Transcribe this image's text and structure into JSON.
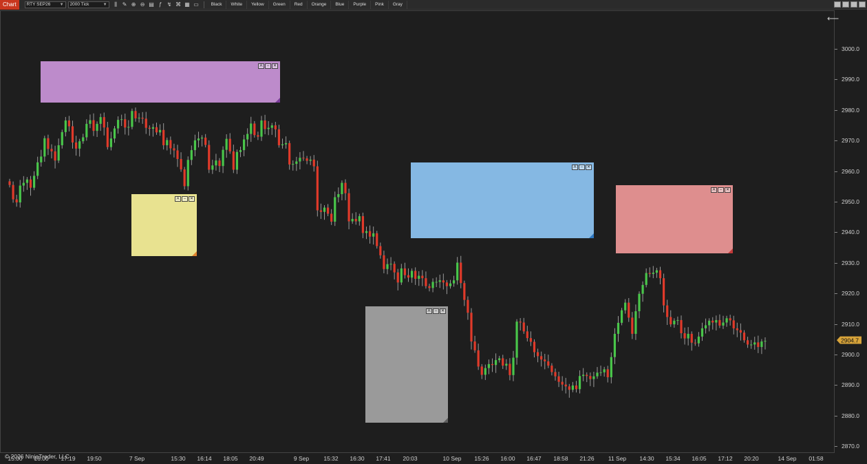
{
  "toolbar": {
    "tab_label": "Chart",
    "instrument": "RTY SEP26",
    "interval": "2000 Tick",
    "tools": [
      {
        "name": "bar-chart-icon",
        "glyph": "⫼"
      },
      {
        "name": "pencil-icon",
        "glyph": "✎"
      },
      {
        "name": "zoom-in-icon",
        "glyph": "⊕"
      },
      {
        "name": "zoom-out-icon",
        "glyph": "⊖"
      },
      {
        "name": "properties-icon",
        "glyph": "▤"
      },
      {
        "name": "indicators-icon",
        "glyph": "ƒ"
      },
      {
        "name": "strategies-icon",
        "glyph": "↯"
      },
      {
        "name": "templates-icon",
        "glyph": "⌘"
      },
      {
        "name": "chart-trader-icon",
        "glyph": "▦"
      },
      {
        "name": "note-icon",
        "glyph": "▭"
      }
    ],
    "color_buttons": [
      "Black",
      "White",
      "Yellow",
      "Green",
      "Red",
      "Orange",
      "Blue",
      "Purple",
      "Pink",
      "Gray"
    ]
  },
  "price_axis": {
    "labels": [
      "3000.0",
      "2990.0",
      "2980.0",
      "2970.0",
      "2960.0",
      "2950.0",
      "2940.0",
      "2930.0",
      "2920.0",
      "2910.0",
      "2900.0",
      "2890.0",
      "2880.0",
      "2870.0"
    ],
    "last_price": "2904.7"
  },
  "time_axis": {
    "labels": [
      "15:00",
      "16:00",
      "17:19",
      "19:50",
      "7 Sep",
      "15:30",
      "16:14",
      "18:05",
      "20:49",
      "9 Sep",
      "15:32",
      "16:30",
      "17:41",
      "20:03",
      "10 Sep",
      "15:26",
      "16:00",
      "16:47",
      "18:58",
      "21:26",
      "11 Sep",
      "14:30",
      "15:34",
      "16:05",
      "17:12",
      "20:20",
      "14 Sep",
      "01:58"
    ]
  },
  "copyright": "© 2026 NinjaTrader, LLC",
  "colors": {
    "up": "#49c64a",
    "down": "#e03a2a",
    "wick": "#9a9a9a",
    "background": "#1e1e1e"
  },
  "notes": [
    {
      "name": "sticky-note-purple",
      "color": "#bd8bcb",
      "corner": "#7b3c9a"
    },
    {
      "name": "sticky-note-yellow",
      "color": "#e8e290",
      "corner": "#e0832e"
    },
    {
      "name": "sticky-note-blue",
      "color": "#85b8e3",
      "corner": "#2e78c2"
    },
    {
      "name": "sticky-note-gray",
      "color": "#9a9a9a",
      "corner": "#5e5e5e"
    },
    {
      "name": "sticky-note-pink",
      "color": "#de8e8e",
      "corner": "#c23a3a"
    }
  ],
  "note_controls": {
    "font": "A",
    "minimize": "–",
    "close": "✕"
  },
  "chart_data": {
    "type": "candlestick",
    "ylim": [
      2866,
      3012
    ],
    "closes": [
      2955.7,
      2951.0,
      2950.0,
      2955.5,
      2956.4,
      2957.5,
      2954.8,
      2958.7,
      2963.1,
      2965.0,
      2971.0,
      2967.5,
      2966.7,
      2963.7,
      2968.7,
      2973.0,
      2976.8,
      2974.9,
      2969.6,
      2967.6,
      2970.0,
      2971.3,
      2975.7,
      2976.9,
      2973.4,
      2975.7,
      2977.9,
      2974.5,
      2968.1,
      2970.9,
      2974.2,
      2977.0,
      2977.2,
      2974.5,
      2974.7,
      2979.9,
      2977.5,
      2977.7,
      2977.4,
      2974.4,
      2974.1,
      2974.6,
      2972.9,
      2973.7,
      2968.7,
      2970.4,
      2967.7,
      2967.0,
      2964.2,
      2960.8,
      2955.3,
      2963.9,
      2967.1,
      2970.3,
      2970.9,
      2971.2,
      2968.8,
      2960.7,
      2962.1,
      2963.7,
      2961.9,
      2967.2,
      2970.8,
      2966.7,
      2960.7,
      2966.5,
      2967.1,
      2970.6,
      2972.4,
      2975.8,
      2972.0,
      2971.5,
      2976.8,
      2974.0,
      2974.4,
      2975.2,
      2973.9,
      2968.7,
      2969.0,
      2969.4,
      2962.4,
      2962.6,
      2963.4,
      2964.6,
      2964.4,
      2963.6,
      2964.0,
      2961.8,
      2947.4,
      2946.9,
      2948.3,
      2946.3,
      2943.7,
      2951.7,
      2952.7,
      2956.4,
      2953.0,
      2943.8,
      2944.6,
      2943.8,
      2945.5,
      2940.0,
      2940.6,
      2938.8,
      2939.9,
      2935.7,
      2932.7,
      2928.2,
      2929.8,
      2929.9,
      2927.1,
      2923.8,
      2928.4,
      2926.2,
      2925.4,
      2927.6,
      2925.0,
      2926.0,
      2925.2,
      2922.6,
      2922.0,
      2924.0,
      2924.0,
      2924.5,
      2923.8,
      2922.6,
      2923.5,
      2924.5,
      2930.3,
      2923.6,
      2918.1,
      2913.9,
      2904.5,
      2901.6,
      2896.3,
      2893.6,
      2895.8,
      2897.1,
      2896.8,
      2898.4,
      2899.0,
      2896.6,
      2897.2,
      2893.5,
      2899.2,
      2911.0,
      2910.7,
      2907.8,
      2905.6,
      2904.4,
      2901.0,
      2899.7,
      2898.6,
      2898.0,
      2896.6,
      2894.5,
      2893.1,
      2891.3,
      2890.4,
      2889.8,
      2888.7,
      2890.1,
      2888.9,
      2893.2,
      2893.6,
      2893.2,
      2892.2,
      2893.1,
      2894.3,
      2894.4,
      2895.4,
      2892.8,
      2899.4,
      2907.0,
      2910.6,
      2914.7,
      2917.2,
      2912.3,
      2907.0,
      2914.4,
      2920.1,
      2923.0,
      2926.9,
      2926.6,
      2927.0,
      2927.8,
      2925.2,
      2916.3,
      2912.5,
      2910.1,
      2911.3,
      2911.5,
      2907.2,
      2905.5,
      2907.0,
      2904.1,
      2903.9,
      2906.1,
      2908.8,
      2909.8,
      2911.3,
      2910.7,
      2911.5,
      2909.7,
      2910.7,
      2912.1,
      2911.4,
      2908.8,
      2908.2,
      2907.4,
      2904.9,
      2903.5,
      2903.5,
      2904.2,
      2902.7,
      2904.5,
      2904.7
    ]
  }
}
